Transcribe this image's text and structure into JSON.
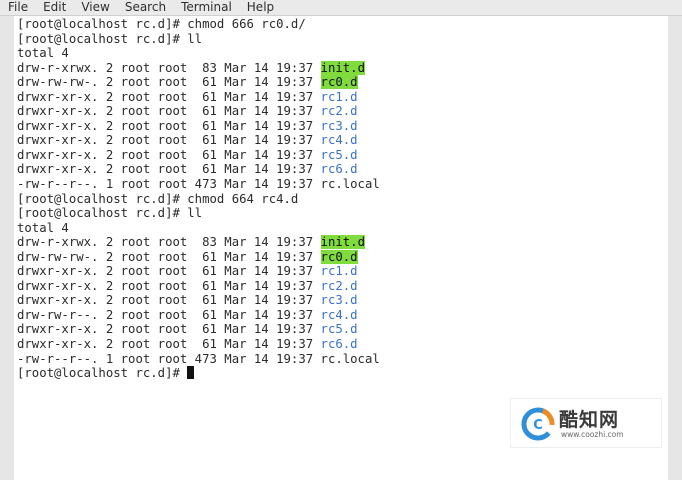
{
  "menu": [
    "File",
    "Edit",
    "View",
    "Search",
    "Terminal",
    "Help"
  ],
  "terminal": {
    "lines": [
      [
        {
          "t": "[root@localhost rc.d]# chmod 666 rc0.d/"
        }
      ],
      [
        {
          "t": "[root@localhost rc.d]# ll"
        }
      ],
      [
        {
          "t": "total 4"
        }
      ],
      [
        {
          "t": "drw-r-xrwx. 2 root root  83 Mar 14 19:37 "
        },
        {
          "t": "init.d",
          "style": "hl-green"
        }
      ],
      [
        {
          "t": "drw-rw-rw-. 2 root root  61 Mar 14 19:37 "
        },
        {
          "t": "rc0.d",
          "style": "hl-green"
        }
      ],
      [
        {
          "t": "drwxr-xr-x. 2 root root  61 Mar 14 19:37 "
        },
        {
          "t": "rc1.d",
          "style": "dir-blue"
        }
      ],
      [
        {
          "t": "drwxr-xr-x. 2 root root  61 Mar 14 19:37 "
        },
        {
          "t": "rc2.d",
          "style": "dir-blue"
        }
      ],
      [
        {
          "t": "drwxr-xr-x. 2 root root  61 Mar 14 19:37 "
        },
        {
          "t": "rc3.d",
          "style": "dir-blue"
        }
      ],
      [
        {
          "t": "drwxr-xr-x. 2 root root  61 Mar 14 19:37 "
        },
        {
          "t": "rc4.d",
          "style": "dir-blue"
        }
      ],
      [
        {
          "t": "drwxr-xr-x. 2 root root  61 Mar 14 19:37 "
        },
        {
          "t": "rc5.d",
          "style": "dir-blue"
        }
      ],
      [
        {
          "t": "drwxr-xr-x. 2 root root  61 Mar 14 19:37 "
        },
        {
          "t": "rc6.d",
          "style": "dir-blue"
        }
      ],
      [
        {
          "t": "-rw-r--r--. 1 root root 473 Mar 14 19:37 rc.local"
        }
      ],
      [
        {
          "t": "[root@localhost rc.d]# chmod 664 rc4.d"
        }
      ],
      [
        {
          "t": "[root@localhost rc.d]# ll"
        }
      ],
      [
        {
          "t": "total 4"
        }
      ],
      [
        {
          "t": "drw-r-xrwx. 2 root root  83 Mar 14 19:37 "
        },
        {
          "t": "init.d",
          "style": "hl-green"
        }
      ],
      [
        {
          "t": "drw-rw-rw-. 2 root root  61 Mar 14 19:37 "
        },
        {
          "t": "rc0.d",
          "style": "hl-green"
        }
      ],
      [
        {
          "t": "drwxr-xr-x. 2 root root  61 Mar 14 19:37 "
        },
        {
          "t": "rc1.d",
          "style": "dir-blue"
        }
      ],
      [
        {
          "t": "drwxr-xr-x. 2 root root  61 Mar 14 19:37 "
        },
        {
          "t": "rc2.d",
          "style": "dir-blue"
        }
      ],
      [
        {
          "t": "drwxr-xr-x. 2 root root  61 Mar 14 19:37 "
        },
        {
          "t": "rc3.d",
          "style": "dir-blue"
        }
      ],
      [
        {
          "t": "drw-rw-r--. 2 root root  61 Mar 14 19:37 "
        },
        {
          "t": "rc4.d",
          "style": "dir-blue"
        }
      ],
      [
        {
          "t": "drwxr-xr-x. 2 root root  61 Mar 14 19:37 "
        },
        {
          "t": "rc5.d",
          "style": "dir-blue"
        }
      ],
      [
        {
          "t": "drwxr-xr-x. 2 root root  61 Mar 14 19:37 "
        },
        {
          "t": "rc6.d",
          "style": "dir-blue"
        }
      ],
      [
        {
          "t": "-rw-r--r--. 1 root root 473 Mar 14 19:37 rc.local"
        }
      ]
    ],
    "prompt": "[root@localhost rc.d]# "
  },
  "watermark": {
    "name": "酷知网",
    "url": "www.coozhi.com"
  },
  "colors": {
    "highlight_green": "#7fdc3c",
    "dir_blue": "#3a72c6",
    "text": "#2b2b2b",
    "logo_blue": "#2f8fd8",
    "logo_orange": "#f08a24"
  }
}
